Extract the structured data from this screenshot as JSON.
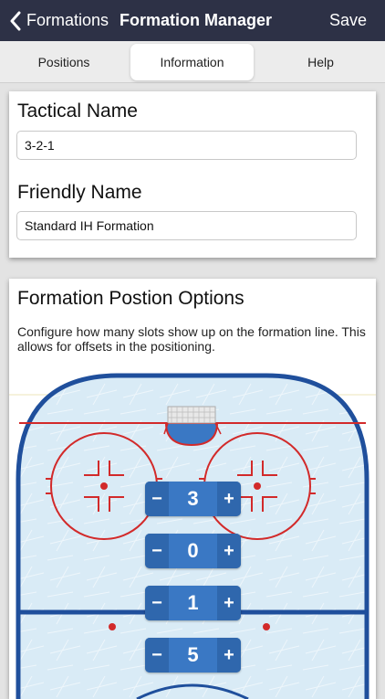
{
  "nav": {
    "back_label": "Formations",
    "title": "Formation Manager",
    "save_label": "Save"
  },
  "tabs": [
    {
      "label": "Positions"
    },
    {
      "label": "Information"
    },
    {
      "label": "Help"
    }
  ],
  "active_tab": "Information",
  "tactical": {
    "label": "Tactical Name",
    "value": "3-2-1"
  },
  "friendly": {
    "label": "Friendly Name",
    "value": "Standard IH Formation"
  },
  "options": {
    "title": "Formation Postion Options",
    "description": "Configure how many slots show up on the formation line. This allows for offsets in the positioning."
  },
  "steppers": [
    {
      "value": "3",
      "minus": "−",
      "plus": "+"
    },
    {
      "value": "0",
      "minus": "−",
      "plus": "+"
    },
    {
      "value": "1",
      "minus": "−",
      "plus": "+"
    },
    {
      "value": "5",
      "minus": "−",
      "plus": "+"
    }
  ],
  "colors": {
    "nav_bg": "#2d3146",
    "rink_blue": "#1f4f9c",
    "rink_red": "#d22a2a",
    "stepper_blue": "#3a78c4"
  }
}
